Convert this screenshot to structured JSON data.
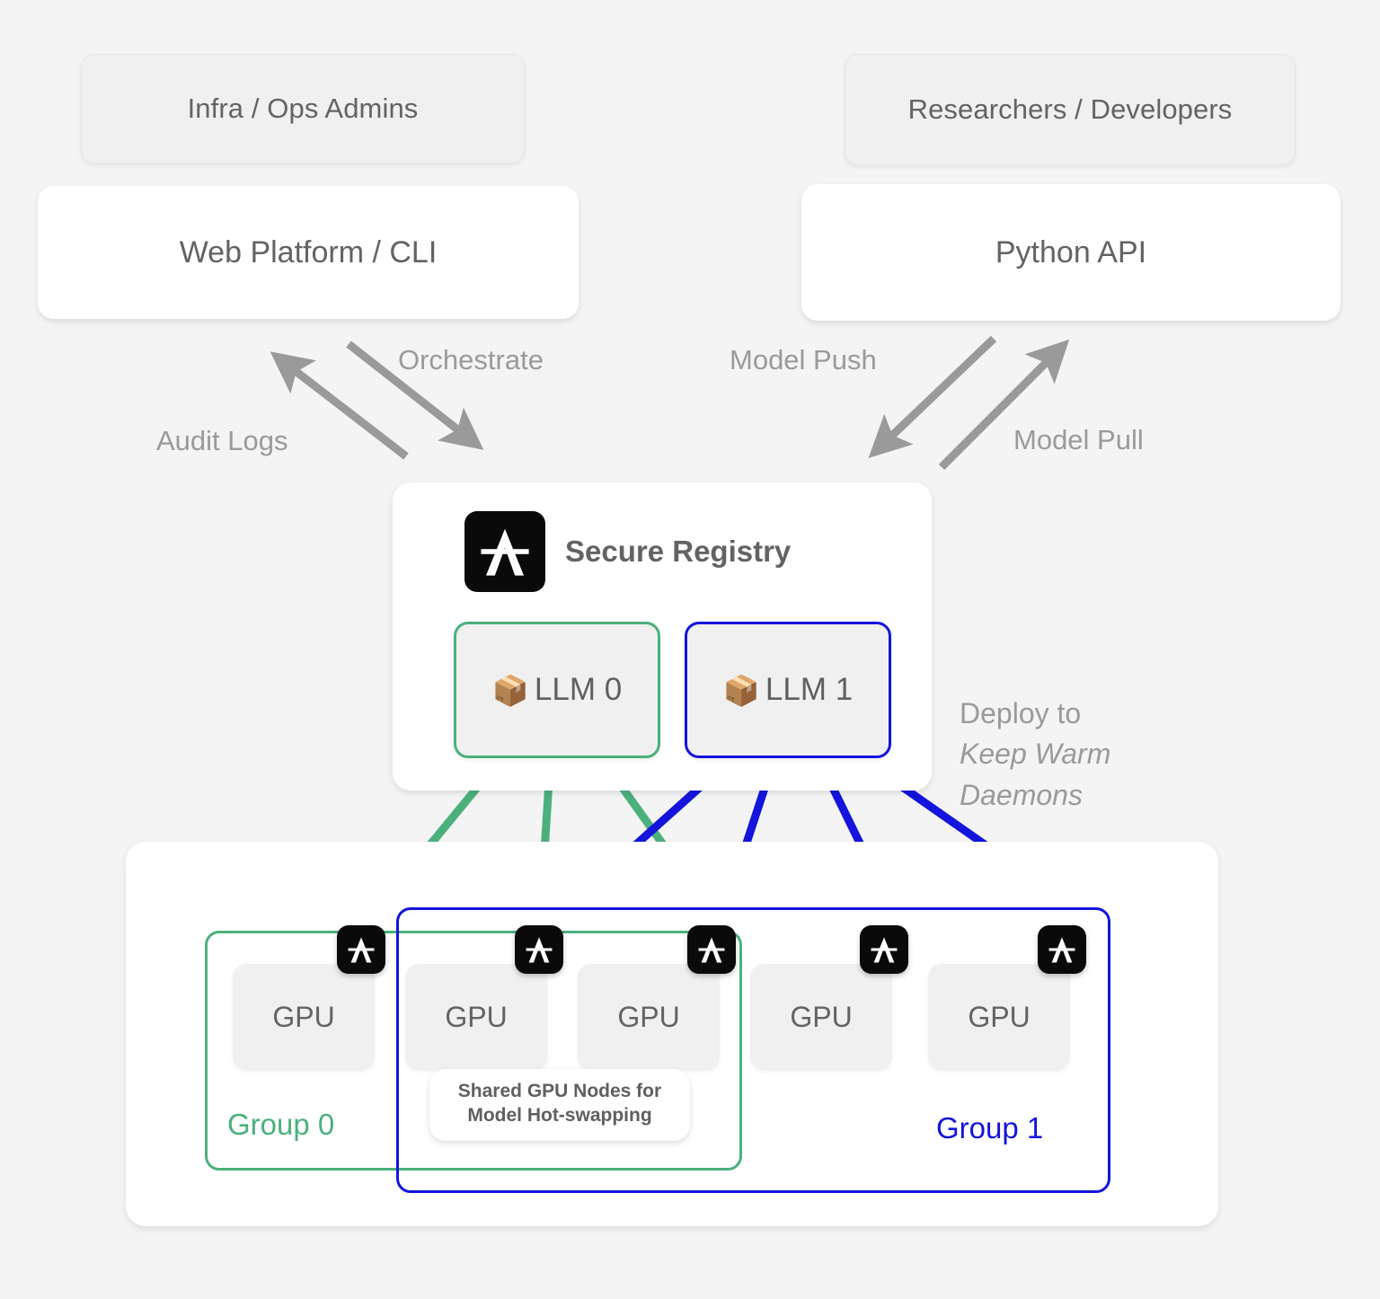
{
  "colors": {
    "background": "#f4f4f4",
    "card": "#ffffff",
    "muted_fill": "#f0f0f0",
    "text": "#636363",
    "label_muted": "#9a9a9a",
    "group0_green": "#4cb07d",
    "group1_blue": "#1414dc",
    "logo_black": "#0a0a0a"
  },
  "actors": [
    {
      "id": "infra-ops-admins",
      "label": "Infra / Ops Admins"
    },
    {
      "id": "researchers-developers",
      "label": "Researchers / Developers"
    }
  ],
  "interfaces": [
    {
      "id": "web-platform-cli",
      "label": "Web Platform / CLI"
    },
    {
      "id": "python-api",
      "label": "Python API"
    }
  ],
  "edges": [
    {
      "id": "orchestrate",
      "label": "Orchestrate",
      "direction": "down-right",
      "color": "#9a9a9a"
    },
    {
      "id": "audit-logs",
      "label": "Audit Logs",
      "direction": "up-left",
      "color": "#9a9a9a"
    },
    {
      "id": "model-push",
      "label": "Model Push",
      "direction": "down-left",
      "color": "#9a9a9a"
    },
    {
      "id": "model-pull",
      "label": "Model Pull",
      "direction": "up-right",
      "color": "#9a9a9a"
    }
  ],
  "registry": {
    "title": "Secure Registry",
    "logo_icon": "crossed-a-logo-icon",
    "models": [
      {
        "id": "llm-0",
        "label": "LLM 0",
        "icon": "package-icon",
        "glyph": "📦",
        "accent": "#4cb07d"
      },
      {
        "id": "llm-1",
        "label": "LLM 1",
        "icon": "package-icon",
        "glyph": "📦",
        "accent": "#1414dc"
      }
    ]
  },
  "deploy_note": {
    "line1": "Deploy to",
    "line2": "Keep Warm",
    "line3": "Daemons"
  },
  "fleet": {
    "shared_note": {
      "line1": "Shared GPU Nodes for",
      "line2": "Model Hot-swapping"
    },
    "nodes": [
      {
        "id": "gpu-0",
        "label": "GPU",
        "daemon_icon": "crossed-a-logo-icon"
      },
      {
        "id": "gpu-1",
        "label": "GPU",
        "daemon_icon": "crossed-a-logo-icon"
      },
      {
        "id": "gpu-2",
        "label": "GPU",
        "daemon_icon": "crossed-a-logo-icon"
      },
      {
        "id": "gpu-3",
        "label": "GPU",
        "daemon_icon": "crossed-a-logo-icon"
      },
      {
        "id": "gpu-4",
        "label": "GPU",
        "daemon_icon": "crossed-a-logo-icon"
      }
    ],
    "groups": [
      {
        "id": "group-0",
        "label": "Group 0",
        "color": "#4cb07d",
        "members": [
          "gpu-0",
          "gpu-1",
          "gpu-2"
        ]
      },
      {
        "id": "group-1",
        "label": "Group 1",
        "color": "#1414dc",
        "members": [
          "gpu-1",
          "gpu-2",
          "gpu-3",
          "gpu-4"
        ]
      }
    ]
  },
  "deploy_edges": [
    {
      "from": "llm-0",
      "to": "gpu-0",
      "color": "#4cb07d"
    },
    {
      "from": "llm-0",
      "to": "gpu-1",
      "color": "#4cb07d"
    },
    {
      "from": "llm-0",
      "to": "gpu-2",
      "color": "#4cb07d"
    },
    {
      "from": "llm-1",
      "to": "gpu-1",
      "color": "#1414dc"
    },
    {
      "from": "llm-1",
      "to": "gpu-2",
      "color": "#1414dc"
    },
    {
      "from": "llm-1",
      "to": "gpu-3",
      "color": "#1414dc"
    },
    {
      "from": "llm-1",
      "to": "gpu-4",
      "color": "#1414dc"
    }
  ]
}
